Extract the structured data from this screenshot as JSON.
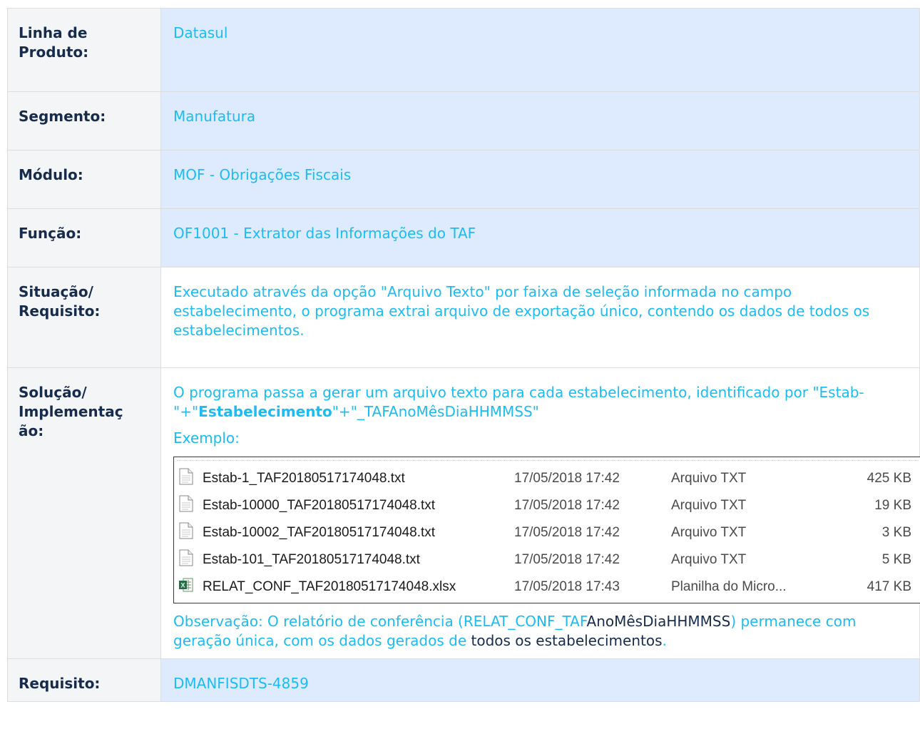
{
  "rows": [
    {
      "label_line1": "Linha de",
      "label_line2": "Produto:",
      "value": "Datasul"
    },
    {
      "label": "Segmento:",
      "value": "Manufatura"
    },
    {
      "label": "Módulo:",
      "value": "MOF - Obrigações Fiscais"
    },
    {
      "label": "Função:",
      "value": "OF1001 - Extrator das Informações do TAF"
    },
    {
      "label_line1": "Situação/",
      "label_line2": "Requisito:",
      "value": "Executado através da opção \"Arquivo Texto\" por faixa de seleção informada no campo estabelecimento, o programa extrai arquivo de exportação único, contendo os dados de todos os estabelecimentos."
    },
    {
      "label_line1": "Solução/",
      "label_line2": "Implementaç",
      "label_line3": "ão:"
    },
    {
      "label": "Requisito:",
      "value": "DMANFISDTS-4859"
    }
  ],
  "solution": {
    "p1_a": "O programa passa a gerar um arquivo texto para cada estabelecimento, identificado por \"Estab-\"+\"",
    "p1_bold": "Estabelecimento",
    "p1_b": "\"+\"_TAFAnoMêsDiaHHMMSS\"",
    "example_label": "Exemplo:",
    "obs_a": "Observação: O relatório de conferência (RELAT_CONF_TAF",
    "obs_b": "AnoMêsDiaHHMMSS",
    "obs_c": ") permanece com geração única, com os dados gerados de ",
    "obs_d": "todos os estabelecimentos",
    "obs_e": "."
  },
  "files": [
    {
      "name": "Estab-1_TAF20180517174048.txt",
      "date": "17/05/2018 17:42",
      "type": "Arquivo TXT",
      "size": "425 KB",
      "icon": "text-file-icon"
    },
    {
      "name": "Estab-10000_TAF20180517174048.txt",
      "date": "17/05/2018 17:42",
      "type": "Arquivo TXT",
      "size": "19 KB",
      "icon": "text-file-icon"
    },
    {
      "name": "Estab-10002_TAF20180517174048.txt",
      "date": "17/05/2018 17:42",
      "type": "Arquivo TXT",
      "size": "3 KB",
      "icon": "text-file-icon"
    },
    {
      "name": "Estab-101_TAF20180517174048.txt",
      "date": "17/05/2018 17:42",
      "type": "Arquivo TXT",
      "size": "5 KB",
      "icon": "text-file-icon"
    },
    {
      "name": "RELAT_CONF_TAF20180517174048.xlsx",
      "date": "17/05/2018 17:43",
      "type": "Planilha do Micro...",
      "size": "417 KB",
      "icon": "excel-file-icon"
    }
  ],
  "colors": {
    "link_blue": "#1bbcf3",
    "label_bg": "#f4f5f7",
    "value_bg": "#deebff",
    "text_dark": "#172b4d"
  }
}
